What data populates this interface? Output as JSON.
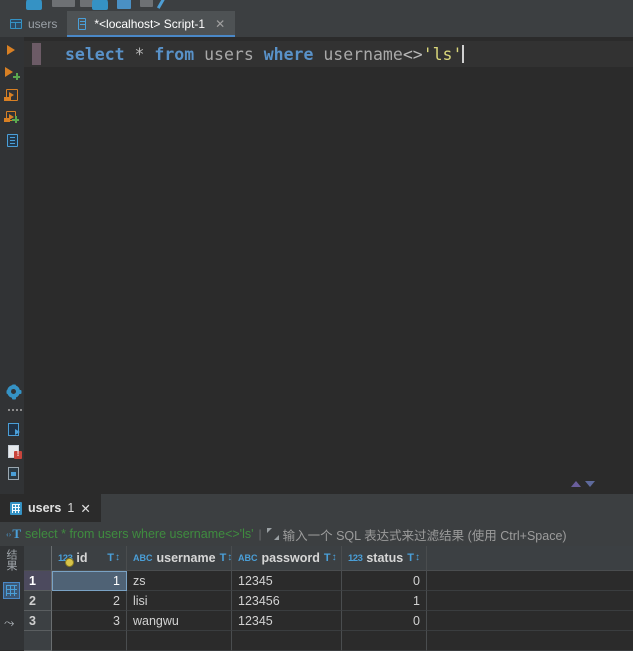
{
  "window": {
    "theme_bg": "#2b2b2b",
    "accent": "#4a88c7"
  },
  "editor_tabs": {
    "items": [
      {
        "label": "users",
        "icon": "db-table-icon",
        "active": false,
        "closable": false
      },
      {
        "label": "*<localhost> Script-1",
        "icon": "console-icon",
        "active": true,
        "closable": true,
        "close_label": "✕"
      }
    ]
  },
  "gutter": {
    "markers": [
      {
        "name": "run-statement-icon"
      },
      {
        "name": "run-statement-add-icon"
      },
      {
        "name": "run-script-icon"
      },
      {
        "name": "run-script-add-icon"
      },
      {
        "name": "open-script-icon"
      }
    ],
    "tools": [
      {
        "name": "settings-gear-icon"
      },
      {
        "name": "more-dots-icon"
      },
      {
        "name": "export-data-icon"
      },
      {
        "name": "error-document-icon"
      },
      {
        "name": "image-document-icon"
      }
    ]
  },
  "editor": {
    "code_tokens": [
      {
        "text": "select",
        "type": "keyword"
      },
      {
        "text": " ",
        "type": "plain"
      },
      {
        "text": "*",
        "type": "operator"
      },
      {
        "text": " ",
        "type": "plain"
      },
      {
        "text": "from",
        "type": "keyword"
      },
      {
        "text": " ",
        "type": "plain"
      },
      {
        "text": "users",
        "type": "identifier"
      },
      {
        "text": " ",
        "type": "plain"
      },
      {
        "text": "where",
        "type": "keyword"
      },
      {
        "text": " ",
        "type": "plain"
      },
      {
        "text": "username",
        "type": "identifier"
      },
      {
        "text": "<>",
        "type": "operator"
      },
      {
        "text": "'ls'",
        "type": "string"
      }
    ],
    "full_text": "select * from users where username<>'ls'",
    "colors": {
      "keyword": "#5992c9",
      "identifier": "#a9a9a9",
      "string": "#d9d67a",
      "operator": "#b9b9b9",
      "line_highlight": "#323232",
      "statement_marker": "#6c5b66"
    }
  },
  "results": {
    "tabs": [
      {
        "label": "users",
        "count": "1",
        "icon": "result-grid-icon",
        "close_label": "✕",
        "active": true
      }
    ],
    "filter_bar": {
      "icon_name": "filter-text-icon",
      "sql": "select * from users where username<>'ls'",
      "separator": "|",
      "expand_icon": "expand-icon",
      "placeholder": "输入一个 SQL 表达式来过滤结果 (使用 Ctrl+Space)",
      "sql_color": "#3f8c3f"
    },
    "side_strip": {
      "vertical_label": "结果",
      "grid_icon": "data-grid-icon",
      "transpose_icon": "transpose-icon"
    },
    "grid": {
      "columns": [
        {
          "label": "id",
          "type_icon": "123",
          "type_kind": "number",
          "primary_key": true
        },
        {
          "label": "username",
          "type_icon": "ABC",
          "type_kind": "text",
          "primary_key": false
        },
        {
          "label": "password",
          "type_icon": "ABC",
          "type_kind": "text",
          "primary_key": false
        },
        {
          "label": "status",
          "type_icon": "123",
          "type_kind": "number",
          "primary_key": false
        }
      ],
      "sort_icon": "T",
      "sort_arrow": "↕",
      "rows": [
        {
          "num": "1",
          "id": "1",
          "username": "zs",
          "password": "12345",
          "status": "0",
          "selected": true
        },
        {
          "num": "2",
          "id": "2",
          "username": "lisi",
          "password": "123456",
          "status": "1",
          "selected": false
        },
        {
          "num": "3",
          "id": "3",
          "username": "wangwu",
          "password": "12345",
          "status": "0",
          "selected": false
        }
      ]
    }
  }
}
